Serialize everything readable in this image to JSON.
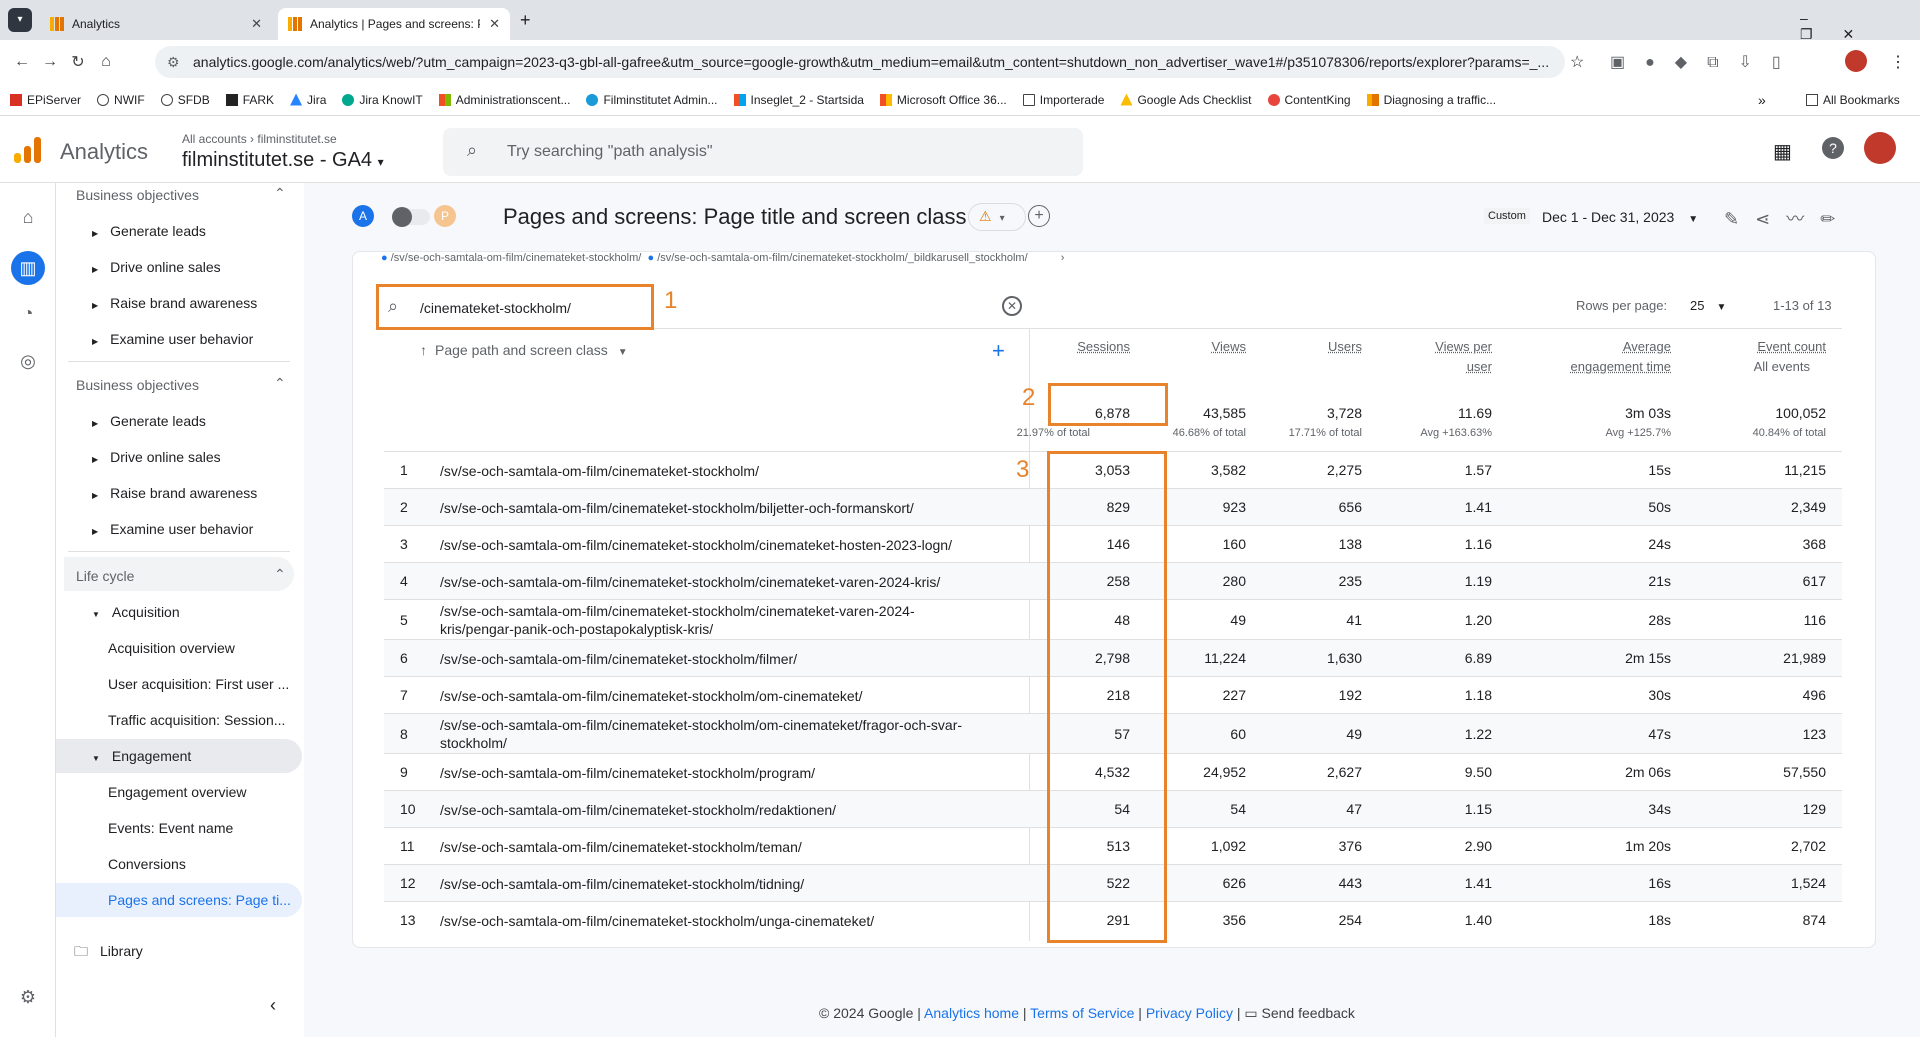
{
  "browser": {
    "tabs": [
      {
        "title": "Analytics"
      },
      {
        "title": "Analytics | Pages and screens: P"
      }
    ],
    "url": "analytics.google.com/analytics/web/?utm_campaign=2023-q3-gbl-all-gafree&utm_source=google-growth&utm_medium=email&utm_content=shutdown_non_advertiser_wave1#/p351078306/reports/explorer?params=_...",
    "bookmarks": [
      "EPiServer",
      "NWIF",
      "SFDB",
      "FARK",
      "Jira",
      "Jira KnowIT",
      "Administrationscent...",
      "Filminstitutet Admin...",
      "Inseglet_2 - Startsida",
      "Microsoft Office 36...",
      "Importerade",
      "Google Ads Checklist",
      "ContentKing",
      "Diagnosing a traffic..."
    ],
    "all_bookmarks": "All Bookmarks"
  },
  "header": {
    "app_name": "Analytics",
    "breadcrumb_root": "All accounts",
    "breadcrumb_leaf": "filminstitutet.se",
    "property": "filminstitutet.se - GA4",
    "search_placeholder": "Try searching \"path analysis\""
  },
  "sidenav": {
    "section1": {
      "title": "Business objectives",
      "items": [
        "Generate leads",
        "Drive online sales",
        "Raise brand awareness",
        "Examine user behavior"
      ]
    },
    "section2": {
      "title": "Business objectives",
      "items": [
        "Generate leads",
        "Drive online sales",
        "Raise brand awareness",
        "Examine user behavior"
      ]
    },
    "section3": {
      "title": "Life cycle",
      "acquisition": "Acquisition",
      "acq_items": [
        "Acquisition overview",
        "User acquisition: First user ...",
        "Traffic acquisition: Session..."
      ],
      "engagement": "Engagement",
      "eng_items": [
        "Engagement overview",
        "Events: Event name",
        "Conversions",
        "Pages and screens: Page ti..."
      ]
    },
    "library": "Library"
  },
  "report": {
    "avatar_a": "A",
    "avatar_p": "P",
    "title": "Pages and screens: Page title and screen class",
    "date_badge": "Custom",
    "date_range": "Dec 1 - Dec 31, 2023",
    "legend_1": "/sv/se-och-samtala-om-film/cinemateket-stockholm/",
    "legend_2": "/sv/se-och-samtala-om-film/cinemateket-stockholm/_bildkarusell_stockholm/"
  },
  "table": {
    "search_value": "/cinemateket-stockholm/",
    "rows_per_page_label": "Rows per page:",
    "rows_per_page": "25",
    "pagination": "1-13 of 13",
    "dimension_header": "Page path and screen class",
    "columns": [
      {
        "label": "Sessions",
        "label2": "",
        "total": "6,878",
        "sub": "21.97% of total"
      },
      {
        "label": "Views",
        "label2": "",
        "total": "43,585",
        "sub": "46.68% of total"
      },
      {
        "label": "Users",
        "label2": "",
        "total": "3,728",
        "sub": "17.71% of total"
      },
      {
        "label": "Views per",
        "label2": "user",
        "total": "11.69",
        "sub": "Avg +163.63%"
      },
      {
        "label": "Average",
        "label2": "engagement time",
        "total": "3m 03s",
        "sub": "Avg +125.7%"
      },
      {
        "label": "Event count",
        "label2": "All events",
        "total": "100,052",
        "sub": "40.84% of total"
      }
    ],
    "rows": [
      {
        "n": "1",
        "path": "/sv/se-och-samtala-om-film/cinemateket-stockholm/",
        "path2": "",
        "v": [
          "3,053",
          "3,582",
          "2,275",
          "1.57",
          "15s",
          "11,215"
        ]
      },
      {
        "n": "2",
        "path": "/sv/se-och-samtala-om-film/cinemateket-stockholm/biljetter-och-formanskort/",
        "path2": "",
        "v": [
          "829",
          "923",
          "656",
          "1.41",
          "50s",
          "2,349"
        ]
      },
      {
        "n": "3",
        "path": "/sv/se-och-samtala-om-film/cinemateket-stockholm/cinemateket-hosten-2023-logn/",
        "path2": "",
        "v": [
          "146",
          "160",
          "138",
          "1.16",
          "24s",
          "368"
        ]
      },
      {
        "n": "4",
        "path": "/sv/se-och-samtala-om-film/cinemateket-stockholm/cinemateket-varen-2024-kris/",
        "path2": "",
        "v": [
          "258",
          "280",
          "235",
          "1.19",
          "21s",
          "617"
        ]
      },
      {
        "n": "5",
        "path": "/sv/se-och-samtala-om-film/cinemateket-stockholm/cinemateket-varen-2024-",
        "path2": "kris/pengar-panik-och-postapokalyptisk-kris/",
        "v": [
          "48",
          "49",
          "41",
          "1.20",
          "28s",
          "116"
        ]
      },
      {
        "n": "6",
        "path": "/sv/se-och-samtala-om-film/cinemateket-stockholm/filmer/",
        "path2": "",
        "v": [
          "2,798",
          "11,224",
          "1,630",
          "6.89",
          "2m 15s",
          "21,989"
        ]
      },
      {
        "n": "7",
        "path": "/sv/se-och-samtala-om-film/cinemateket-stockholm/om-cinemateket/",
        "path2": "",
        "v": [
          "218",
          "227",
          "192",
          "1.18",
          "30s",
          "496"
        ]
      },
      {
        "n": "8",
        "path": "/sv/se-och-samtala-om-film/cinemateket-stockholm/om-cinemateket/fragor-och-svar-",
        "path2": "stockholm/",
        "v": [
          "57",
          "60",
          "49",
          "1.22",
          "47s",
          "123"
        ]
      },
      {
        "n": "9",
        "path": "/sv/se-och-samtala-om-film/cinemateket-stockholm/program/",
        "path2": "",
        "v": [
          "4,532",
          "24,952",
          "2,627",
          "9.50",
          "2m 06s",
          "57,550"
        ]
      },
      {
        "n": "10",
        "path": "/sv/se-och-samtala-om-film/cinemateket-stockholm/redaktionen/",
        "path2": "",
        "v": [
          "54",
          "54",
          "47",
          "1.15",
          "34s",
          "129"
        ]
      },
      {
        "n": "11",
        "path": "/sv/se-och-samtala-om-film/cinemateket-stockholm/teman/",
        "path2": "",
        "v": [
          "513",
          "1,092",
          "376",
          "2.90",
          "1m 20s",
          "2,702"
        ]
      },
      {
        "n": "12",
        "path": "/sv/se-och-samtala-om-film/cinemateket-stockholm/tidning/",
        "path2": "",
        "v": [
          "522",
          "626",
          "443",
          "1.41",
          "16s",
          "1,524"
        ]
      },
      {
        "n": "13",
        "path": "/sv/se-och-samtala-om-film/cinemateket-stockholm/unga-cinemateket/",
        "path2": "",
        "v": [
          "291",
          "356",
          "254",
          "1.40",
          "18s",
          "874"
        ]
      }
    ]
  },
  "annotations": {
    "label1": "1",
    "label2": "2",
    "label3": "3",
    "color": "#e8822b"
  },
  "footer": {
    "copyright": "© 2024 Google |",
    "analytics_home": "Analytics home",
    "terms": "Terms of Service",
    "privacy": "Privacy Policy",
    "feedback": "Send feedback"
  }
}
